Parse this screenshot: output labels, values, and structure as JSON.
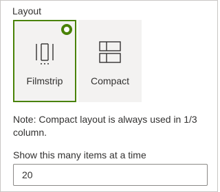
{
  "layout": {
    "label": "Layout",
    "options": [
      {
        "label": "Filmstrip",
        "icon": "filmstrip-icon",
        "selected": true
      },
      {
        "label": "Compact",
        "icon": "compact-icon",
        "selected": false
      }
    ]
  },
  "note": "Note: Compact layout is always used in 1/3 column.",
  "items_field": {
    "label": "Show this many items at a time",
    "value": "20"
  },
  "colors": {
    "accent": "#498205",
    "tile_bg": "#f3f2f1",
    "text": "#323130"
  }
}
